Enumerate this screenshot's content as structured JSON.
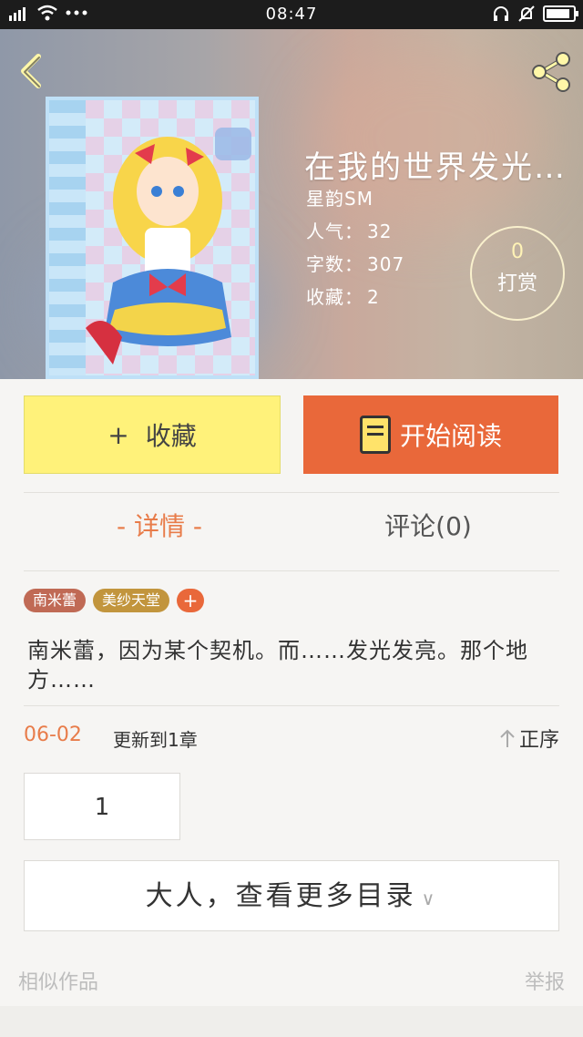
{
  "status_bar": {
    "time": "08:47",
    "left_icons": [
      "signal-icon",
      "wifi-icon",
      "more-dots-icon"
    ],
    "right_icons": [
      "headphones-icon",
      "mute-bell-icon",
      "battery-icon"
    ],
    "battery_level": 0.9
  },
  "header": {
    "back_icon": "back-chevron-icon",
    "share_icon": "share-icon"
  },
  "book": {
    "title": "在我的世界发光…",
    "author": "星韵SM",
    "popularity_label": "人气：",
    "popularity": "32",
    "wordcount_label": "字数：",
    "wordcount": "307",
    "favorites_label": "收藏：",
    "favorites": "2"
  },
  "tip": {
    "count": "0",
    "label": "打赏"
  },
  "actions": {
    "favorite_plus": "+",
    "favorite_label": "收藏",
    "read_label": "开始阅读"
  },
  "tabs": {
    "detail": "- 详情 -",
    "comments": "评论(0)"
  },
  "tags": [
    "南米蕾",
    "美纱天堂"
  ],
  "tag_add": "+",
  "description": "南米蕾，因为某个契机。而……发光发亮。那个地方……",
  "update": {
    "date": "06-02",
    "text": "更新到1章",
    "sort_label": "正序"
  },
  "chapters": [
    "1"
  ],
  "more_toc_label": "大人，查看更多目录",
  "footer": {
    "similar": "相似作品",
    "report": "举报"
  },
  "colors": {
    "accent": "#e9683a",
    "favorite_bg": "#fff27a",
    "tab_active": "#e87c4a"
  }
}
